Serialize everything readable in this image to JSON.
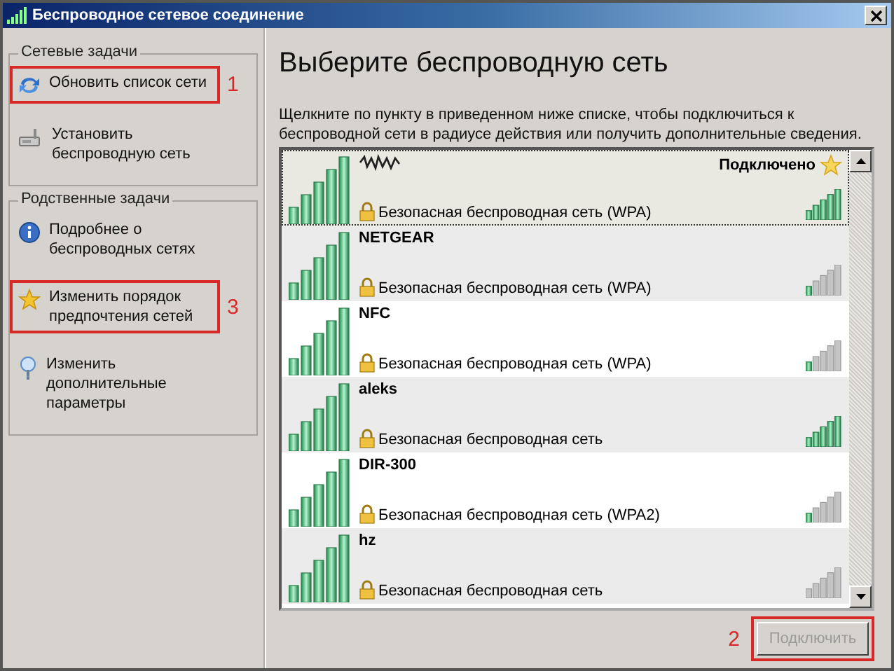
{
  "window": {
    "title": "Беспроводное сетевое соединение"
  },
  "sidebar": {
    "groups": [
      {
        "title": "Сетевые задачи",
        "items": [
          {
            "kind": "refresh",
            "label": "Обновить список сети",
            "highlighted": true,
            "marker": "1"
          },
          {
            "kind": "setup",
            "label": "Установить беспроводную сеть",
            "highlighted": false
          }
        ]
      },
      {
        "title": "Родственные задачи",
        "items": [
          {
            "kind": "info",
            "label": "Подробнее о беспроводных сетях",
            "highlighted": false
          },
          {
            "kind": "star",
            "label": "Изменить порядок предпочтения  сетей",
            "highlighted": true,
            "marker": "3"
          },
          {
            "kind": "advanced",
            "label": "Изменить дополнительные параметры",
            "highlighted": false
          }
        ]
      }
    ]
  },
  "main": {
    "heading": "Выберите беспроводную сеть",
    "description": "Щелкните по пункту в приведенном ниже списке, чтобы подключиться к беспроводной сети в радиусе действия или получить дополнительные сведения.",
    "networks": [
      {
        "name_hidden": true,
        "security": "Безопасная беспроводная сеть (WPA)",
        "status": "Подключено",
        "selected": true,
        "kind": "strong"
      },
      {
        "name": "NETGEAR",
        "security": "Безопасная беспроводная сеть (WPA)",
        "selected": false,
        "kind": "weak"
      },
      {
        "name": "NFC",
        "security": "Безопасная беспроводная сеть (WPA)",
        "selected": false,
        "kind": "weak"
      },
      {
        "name": "aleks",
        "security": "Безопасная беспроводная сеть",
        "selected": false,
        "kind": "strong"
      },
      {
        "name": "DIR-300",
        "security": "Безопасная беспроводная сеть (WPA2)",
        "selected": false,
        "kind": "weak"
      },
      {
        "name": "hz",
        "security": "Безопасная беспроводная сеть",
        "selected": false,
        "kind": "faint"
      }
    ],
    "connect_button": {
      "label": "Подключить",
      "disabled": true,
      "highlighted": true,
      "marker": "2"
    }
  }
}
